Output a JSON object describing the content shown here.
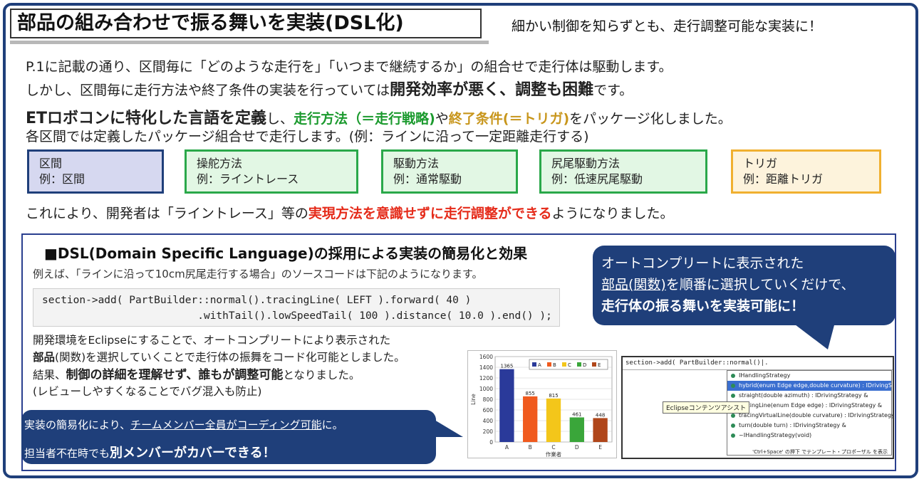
{
  "title": "部品の組み合わせで振る舞いを実装(DSL化)",
  "subtitle": "細かい制御を知らずとも、走行調整可能な実装に！",
  "intro": {
    "l1": "P.1に記載の通り、区間毎に「どのような走行を」「いつまで継続するか」の組合せで走行体は駆動します。",
    "l2_pre": "しかし、区間毎に走行方法や終了条件の実装を行っていては",
    "l2_bold": "開発効率が悪く、調整も困難",
    "l2_post": "です。",
    "l3_bold": "ETロボコンに特化した言語を定義",
    "l3_a": "し、",
    "l3_green": "走行方法（＝走行戦略)",
    "l3_b": "や",
    "l3_gold": "終了条件(＝トリガ)",
    "l3_c": "をパッケージ化しました。",
    "l4": "各区間では定義したパッケージ組合せで走行します。(例：ラインに沿って一定距離走行する)"
  },
  "packages": [
    {
      "name": "区間",
      "example": "例：区間",
      "border": "#1f3f7a",
      "bg": "#d6d8f0"
    },
    {
      "name": "操舵方法",
      "example": "例：ライントレース",
      "border": "#2aa84a",
      "bg": "#e2f7e4"
    },
    {
      "name": "駆動方法",
      "example": "例：通常駆動",
      "border": "#2aa84a",
      "bg": "#e2f7e4"
    },
    {
      "name": "尻尾駆動方法",
      "example": "例：低速尻尾駆動",
      "border": "#2aa84a",
      "bg": "#e2f7e4"
    },
    {
      "name": "トリガ",
      "example": "例：距離トリガ",
      "border": "#f0b030",
      "bg": "#fdf3dc"
    }
  ],
  "result": {
    "pre": "これにより、開発者は「ライントレース」等の",
    "red": "実現方法を意識せずに走行調整ができる",
    "post": "ようになりました。"
  },
  "dsl": {
    "title": "■DSL(Domain Specific Language)の採用による実装の簡易化と効果",
    "sub": "例えば、「ラインに沿って10cm尻尾走行する場合」のソースコードは下記のようになります。",
    "code1": "section->add( PartBuilder::normal().tracingLine( LEFT ).forward( 40 )",
    "code2": "                         .withTail().lowSpeedTail( 100 ).distance( 10.0 ).end() );",
    "b1": "開発環境をEclipseにすることで、オートコンプリートにより表示された",
    "b2_bold": "部品",
    "b2_post": "(関数)を選択していくことで走行体の振舞をコード化可能としました。",
    "b3_pre": "結果、",
    "b3_bold": "制御の詳細を理解せず、誰もが調整可能",
    "b3_post": "となりました。",
    "b4": "(レビューしやすくなることでバグ混入も防止)"
  },
  "callout_left": {
    "l1_pre": "実装の簡易化により、",
    "l1_u": "チームメンバー全員がコーディング可能",
    "l1_post": "に。",
    "l2_pre": "担当者不在時でも",
    "l2_bold": "別メンバーがカバーできる！"
  },
  "callout_right": {
    "l1": "オートコンプリートに表示された",
    "l2_u": "部品(関数)",
    "l2_post": "を順番に選択していくだけで、",
    "l3": "走行体の振る舞いを実装可能に！"
  },
  "chart_data": {
    "type": "bar",
    "categories": [
      "A",
      "B",
      "C",
      "D",
      "E"
    ],
    "values": [
      1365,
      855,
      815,
      461,
      448
    ],
    "colors": [
      "#2a3a9a",
      "#f05a1e",
      "#f3c61a",
      "#3aa63a",
      "#b0461a"
    ],
    "xlabel": "作業者",
    "ylabel": "Line",
    "ylim": [
      0,
      1600
    ],
    "yticks": [
      0,
      200,
      400,
      600,
      800,
      1000,
      1200,
      1400,
      1600
    ],
    "legend": [
      "A",
      "B",
      "C",
      "D",
      "E"
    ],
    "legend_position": "top-right",
    "grid": true
  },
  "eclipse": {
    "code": "section->add( PartBuilder::normal()|.",
    "items": [
      "IHandlingStrategy",
      "hybrid(enum Edge edge,double curvature) : IDrivingStrategy &",
      "straight(double azimuth) : IDrivingStrategy &",
      "tracingLine(enum Edge edge) : IDrivingStrategy &",
      "tracingVirtualLine(double curvature) : IDrivingStrategy &",
      "turn(double turn) : IDrivingStrategy &",
      "~IHandlingStrategy(void)"
    ],
    "tooltip": "Eclipseコンテンツアシスト",
    "footer": "'Ctrl+Space' の押下 でテンプレート・プロポーザル を表示"
  }
}
